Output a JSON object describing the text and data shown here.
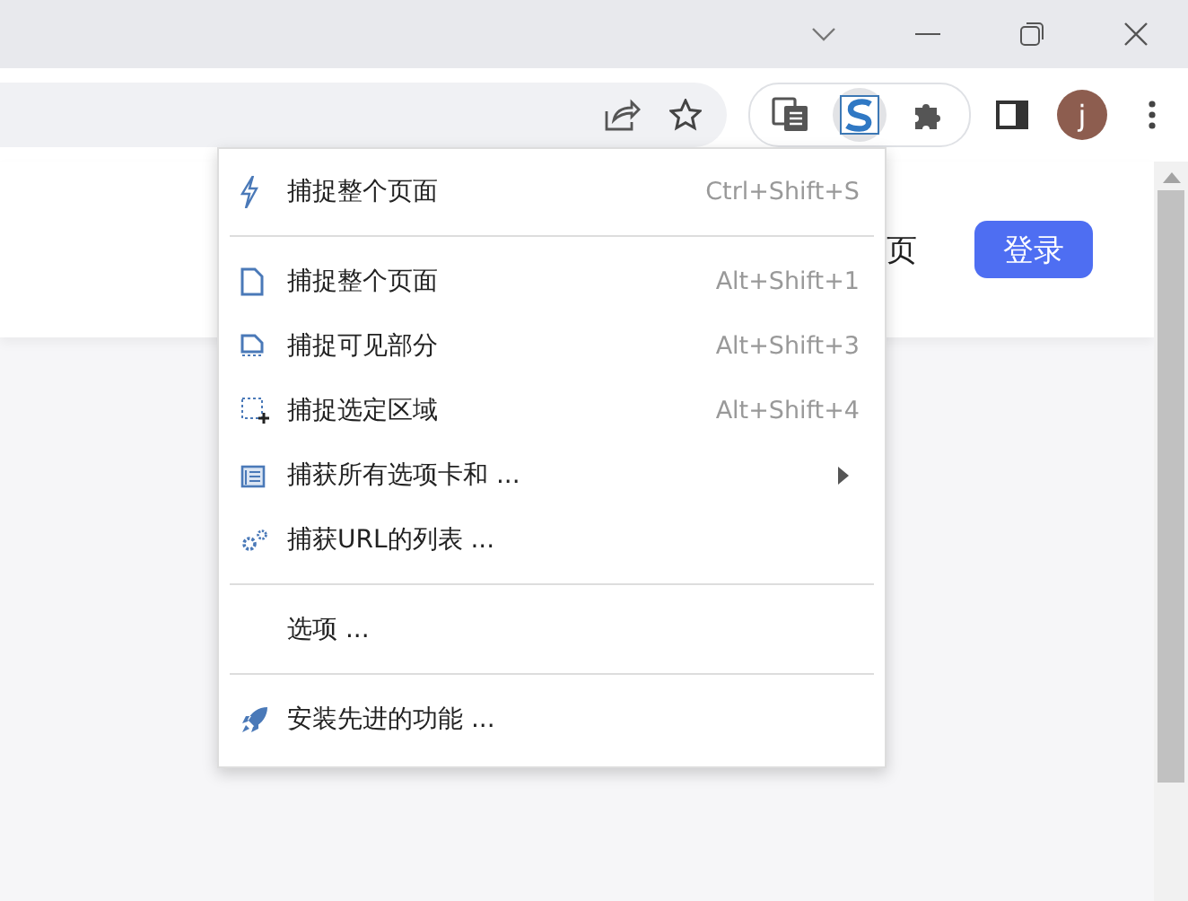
{
  "toolbar": {
    "avatar_letter": "j"
  },
  "page": {
    "nav_text": "页",
    "login_button": "登录"
  },
  "menu": [
    {
      "kind": "item",
      "label": "捕捉整个页面",
      "shortcut": "Ctrl+Shift+S"
    },
    {
      "kind": "separator"
    },
    {
      "kind": "item",
      "label": "捕捉整个页面",
      "shortcut": "Alt+Shift+1"
    },
    {
      "kind": "item",
      "label": "捕捉可见部分",
      "shortcut": "Alt+Shift+3"
    },
    {
      "kind": "item",
      "label": "捕捉选定区域",
      "shortcut": "Alt+Shift+4"
    },
    {
      "kind": "item",
      "label": "捕获所有选项卡和 ...",
      "submenu": true
    },
    {
      "kind": "item",
      "label": "捕获URL的列表 ..."
    },
    {
      "kind": "separator"
    },
    {
      "kind": "item",
      "label": "选项 ..."
    },
    {
      "kind": "separator"
    },
    {
      "kind": "item",
      "label": "安装先进的功能 ..."
    }
  ]
}
